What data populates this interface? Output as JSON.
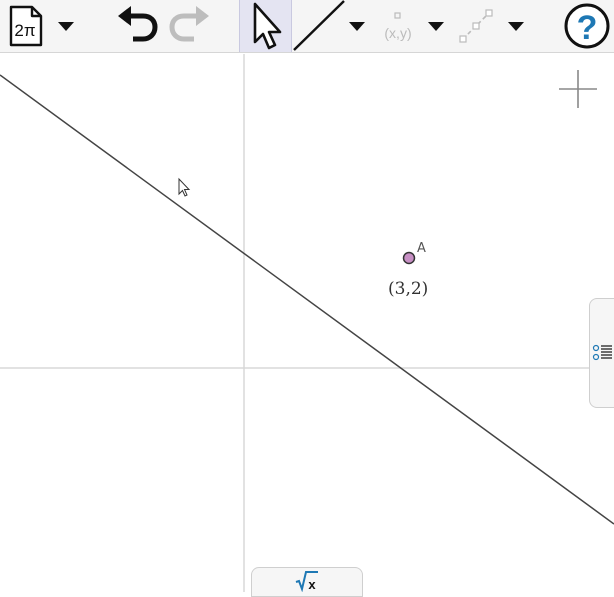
{
  "toolbar": {
    "new_file_label": "2π",
    "point_tool_label": "(x,y)",
    "icons": [
      "document-icon",
      "dropdown-icon",
      "undo-icon",
      "redo-icon",
      "move-cursor-icon",
      "line-tool-icon",
      "point-tool-icon",
      "segment-tool-icon",
      "help-icon"
    ],
    "accent_color": "#1e78b4",
    "active_tool_bg": "#e4e4f2"
  },
  "graphics": {
    "point": {
      "name": "A",
      "coords": "(3,2)",
      "x": 3,
      "y": 2,
      "fill_color": "#c78fc4",
      "stroke_color": "#333333"
    },
    "axis_color": "#d8d8d8",
    "line_color": "#444444"
  },
  "input_bar": {
    "icon": "sqrt-x-icon",
    "icon_text": "x"
  },
  "side_panel": {
    "icon": "algebra-list-icon"
  }
}
